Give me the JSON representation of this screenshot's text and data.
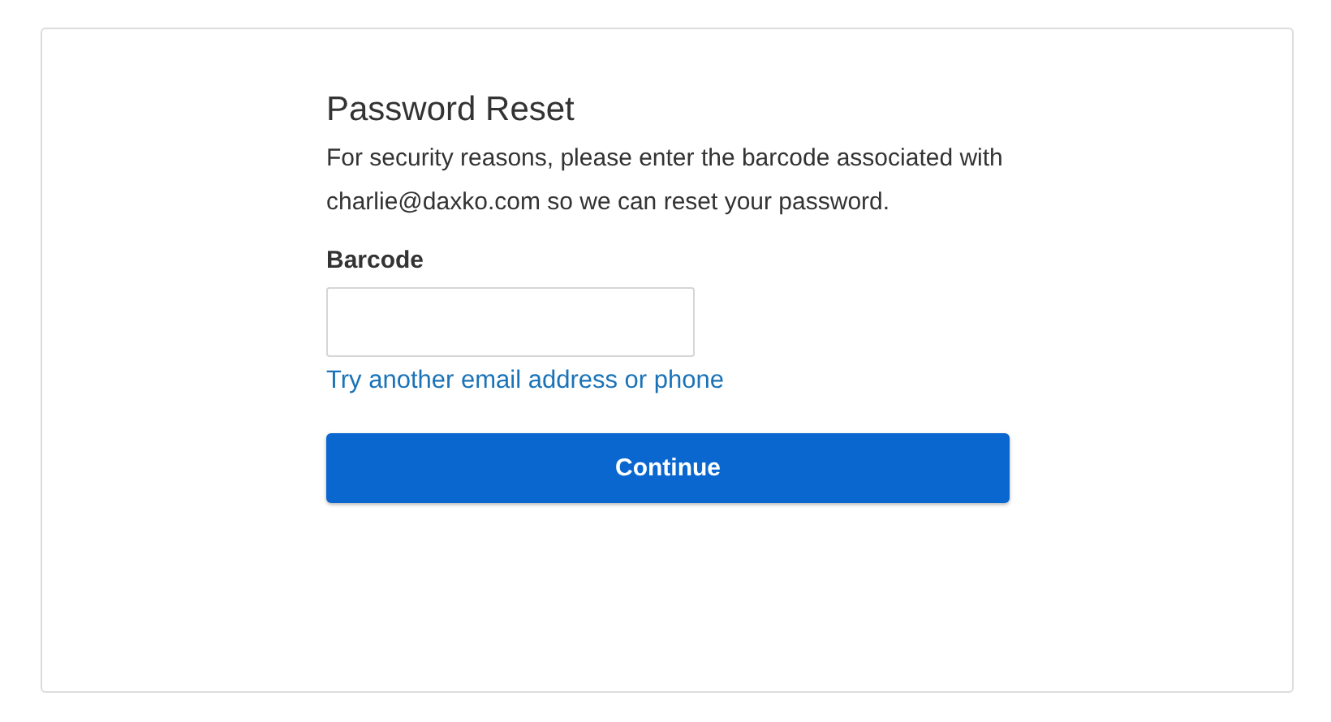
{
  "title": "Password Reset",
  "description": "For security reasons, please enter the barcode associated with charlie@daxko.com so we can reset your password.",
  "field": {
    "label": "Barcode"
  },
  "link": "Try another email address or phone",
  "button": "Continue"
}
